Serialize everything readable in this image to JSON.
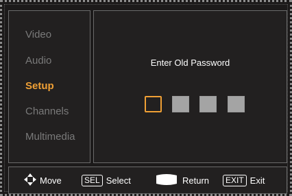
{
  "menu": {
    "items": [
      {
        "label": "Video",
        "active": false
      },
      {
        "label": "Audio",
        "active": false
      },
      {
        "label": "Setup",
        "active": true
      },
      {
        "label": "Channels",
        "active": false
      },
      {
        "label": "Multimedia",
        "active": false
      }
    ]
  },
  "password": {
    "prompt": "Enter Old Password",
    "digit_count": 4,
    "focused_index": 0
  },
  "footer": {
    "move_icon": "four-way-arrows-icon",
    "move_label": "Move",
    "select_key": "SEL",
    "select_label": "Select",
    "return_icon": "return-button-icon",
    "return_label": "Return",
    "exit_key": "EXIT",
    "exit_label": "Exit"
  },
  "colors": {
    "background": "#1c1a1a",
    "accent": "#f0a035",
    "inactive_text": "#7a7a7a",
    "pin_fill": "#a4a4a4"
  }
}
